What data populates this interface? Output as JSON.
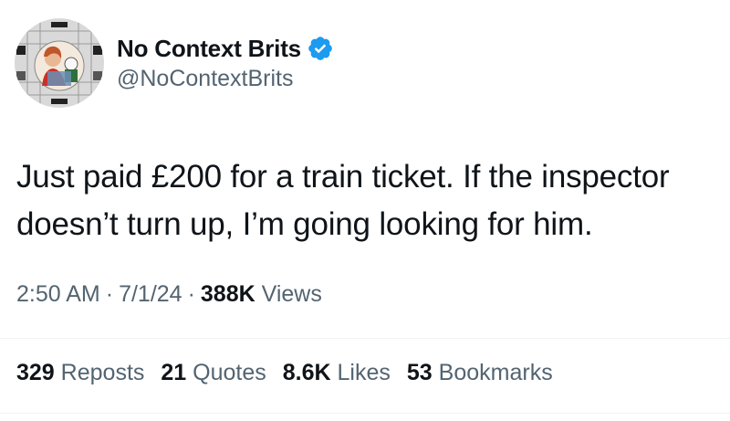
{
  "author": {
    "display_name": "No Context Brits",
    "handle": "@NoContextBrits",
    "avatar_icon": "test-card-avatar",
    "verified_icon": "verified-badge-icon",
    "verified_color": "#1d9bf0"
  },
  "tweet": {
    "text_line1": "Just paid £200 for a train ticket. If the inspector",
    "text_line2": "doesn’t turn up, I’m going looking for him."
  },
  "meta": {
    "time": "2:50 AM",
    "separator": "·",
    "date": "7/1/24",
    "views_count": "388K",
    "views_label": "Views"
  },
  "stats": [
    {
      "count": "329",
      "label": "Reposts"
    },
    {
      "count": "21",
      "label": "Quotes"
    },
    {
      "count": "8.6K",
      "label": "Likes"
    },
    {
      "count": "53",
      "label": "Bookmarks"
    }
  ],
  "colors": {
    "text_primary": "#0f1419",
    "text_secondary": "#536471",
    "divider": "#eff3f4"
  }
}
